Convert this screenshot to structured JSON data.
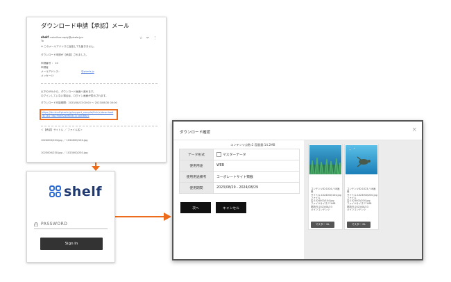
{
  "email": {
    "subject": "ダウンロード申請【承認】メール",
    "sender_name": "shelf",
    "sender_address": "<shelf-no-reply@pixela.jp>",
    "recipient": "To",
    "notice": "※ このメールアドレスに返信しても届きません。",
    "intro": "ダウンロード申請が【承認】されました。",
    "field_id": "申請番号 ： 10",
    "field_applicant": "申請者",
    "field_mail": "メールアドレス：",
    "field_mail_value": "@pixela.jp",
    "field_message": "メッセージ：",
    "instructions_1": "以下のURLから、ダウンロード画面へ進めます。",
    "instructions_2": "ログインしていない場合は、ログイン画面が表示されます。",
    "period": "ダウンロード可能期間：2023/08/23 00:00 ～ 2023/08/30 00:00",
    "url_1": "https://dx.shelf.pixela.jp/support_sample/Link/c/download",
    "url_2": "/4c1b174b1f5dbf2a8f0c8c2c.a4b8fb/c",
    "file_header": "＜【承認】サイトル ／ ファイル名＞",
    "file_1": "1024000/104.jpg ／ 1024000/104.jpg",
    "file_2": "1023000/230.jpg ／ 1023000/230.jpg"
  },
  "login": {
    "logo_text": "shelf",
    "password_label": "PASSWORD",
    "signin_label": "Sign In"
  },
  "modal": {
    "title": "ダウンロード確認",
    "close": "×",
    "count_text": "コンテンツ点数:2 容量量:14.2MB",
    "rows": [
      {
        "key": "データ形式",
        "value": "マスターデータ"
      },
      {
        "key": "使用用途",
        "value": "WEB"
      },
      {
        "key": "使用用途備考",
        "value": "コーポレートサイト掲載"
      },
      {
        "key": "使用期間",
        "value": "2023/08/29 - 2024/08/29"
      }
    ],
    "next_label": "次へ",
    "cancel_label": "キャンセル",
    "cards": [
      {
        "meta_1": "コンテンツID:1024 / 4K画像",
        "meta_2": "サイトル:1024000/104.jpg",
        "meta_3": "ファイル名:1024000/104.jpg",
        "meta_4": "ファイルサイズ:7.1MB",
        "meta_5": "更新日:2023/08/23",
        "meta_6": "メインコンテンツ",
        "button": "マスター DL"
      },
      {
        "meta_1": "コンテンツID:1023 / 4K画像",
        "meta_2": "サイトル:1023000/230.jpg",
        "meta_3": "ファイル名:1023000/230.jpg",
        "meta_4": "ファイルサイズ:7.1MB",
        "meta_5": "更新日:2023/08/23",
        "meta_6": "メインコンテンツ",
        "button": "マスター DL"
      }
    ]
  },
  "colors": {
    "accent_orange": "#ec6c1c",
    "brand_blue": "#2c6bd3",
    "dark_button": "#111111"
  }
}
